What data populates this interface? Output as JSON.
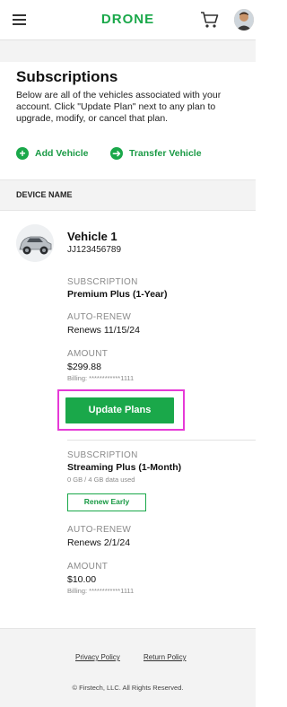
{
  "header": {
    "logo": "DRONE"
  },
  "page": {
    "title": "Subscriptions",
    "intro": "Below are all of the vehicles associated with your account. Click \"Update Plan\" next to any plan to upgrade, modify, or cancel that plan."
  },
  "actions": {
    "add_vehicle": "Add Vehicle",
    "transfer_vehicle": "Transfer Vehicle"
  },
  "table": {
    "column_header": "DEVICE NAME"
  },
  "vehicle": {
    "name": "Vehicle 1",
    "id": "JJ123456789"
  },
  "subscriptions": [
    {
      "subscription_label": "SUBSCRIPTION",
      "plan": "Premium Plus (1-Year)",
      "auto_renew_label": "AUTO-RENEW",
      "auto_renew": "Renews 11/15/24",
      "amount_label": "AMOUNT",
      "amount": "$299.88",
      "billing": "Billing: ************1111",
      "button": "Update Plans"
    },
    {
      "subscription_label": "SUBSCRIPTION",
      "plan": "Streaming Plus (1-Month)",
      "data_used": "0 GB / 4 GB data used",
      "button": "Renew Early",
      "auto_renew_label": "AUTO-RENEW",
      "auto_renew": "Renews 2/1/24",
      "amount_label": "AMOUNT",
      "amount": "$10.00",
      "billing": "Billing: ************1111"
    }
  ],
  "footer": {
    "privacy": "Privacy Policy",
    "return": "Return Policy",
    "copyright": "© Firstech, LLC. All Rights Reserved."
  },
  "colors": {
    "brand_green": "#1aa84a",
    "highlight": "#e63ad7"
  }
}
